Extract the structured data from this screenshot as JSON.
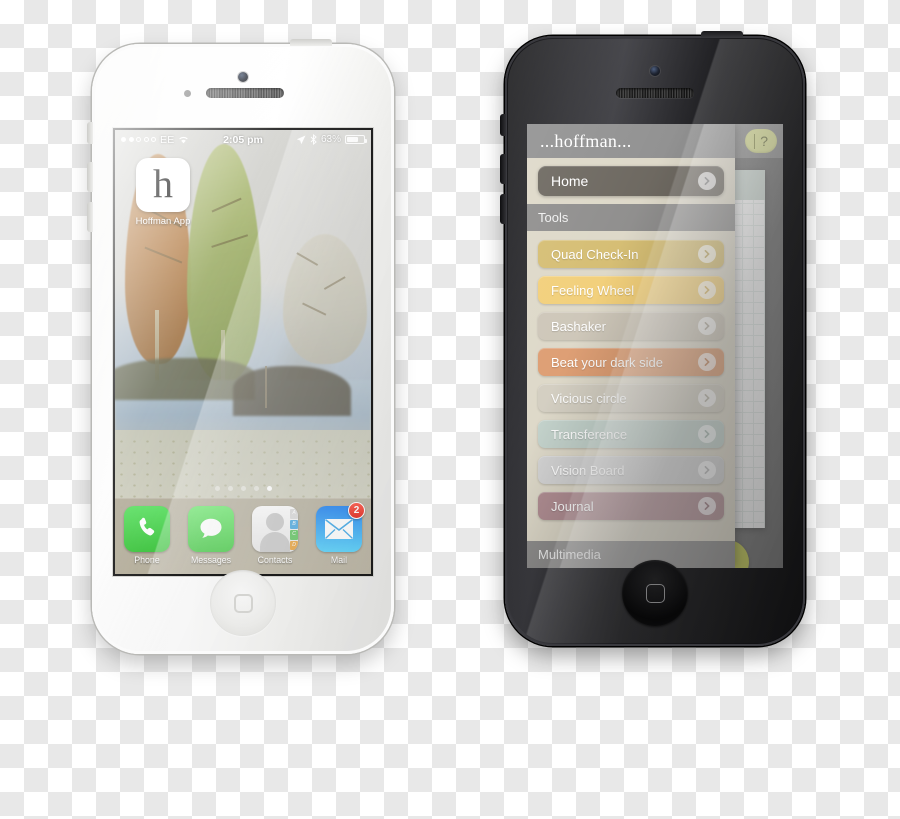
{
  "white_phone": {
    "status_bar": {
      "signal_dots_total": 5,
      "signal_dots_filled": 2,
      "carrier": "EE",
      "wifi": "wifi-icon",
      "time": "2:05 pm",
      "location_icon": "location-arrow-icon",
      "bluetooth_icon": "bluetooth-icon",
      "battery_percent": "63%",
      "battery_level": 63
    },
    "app_icon": {
      "glyph": "h",
      "label": "Hoffman App"
    },
    "page_dots": {
      "total": 5,
      "active_index": 4
    },
    "dock": [
      {
        "label": "Phone",
        "icon": "phone-icon"
      },
      {
        "label": "Messages",
        "icon": "messages-icon"
      },
      {
        "label": "Contacts",
        "icon": "contacts-icon"
      },
      {
        "label": "Mail",
        "icon": "mail-icon",
        "badge": "2"
      }
    ],
    "contacts_tabs": [
      "A",
      "B",
      "C",
      "D"
    ]
  },
  "black_phone": {
    "app": {
      "title": "...hoffman...",
      "help_button": "?",
      "home_item": {
        "label": "Home"
      },
      "sections": [
        {
          "title": "Tools",
          "items": [
            {
              "label": "Quad Check-In",
              "color": "#d5bd72"
            },
            {
              "label": "Feeling Wheel",
              "color": "#f2cf79"
            },
            {
              "label": "Bashaker",
              "color": "#cdc6b8"
            },
            {
              "label": "Beat your dark side",
              "color": "#dd9d72"
            },
            {
              "label": "Vicious circle",
              "color": "#d3cec1"
            },
            {
              "label": "Transference",
              "color": "#c3d2cb"
            },
            {
              "label": "Vision Board",
              "color": "#d3d3d3"
            },
            {
              "label": "Journal",
              "color": "#b08d92"
            }
          ]
        }
      ],
      "bottom_section": "Multimedia"
    }
  },
  "colors": {
    "sidebar_bg": "#ddd8c8",
    "section_header": "#878787",
    "home_row": "#6b665e",
    "help_pill": "#d8dd92",
    "badge_red": "#e01b10"
  }
}
